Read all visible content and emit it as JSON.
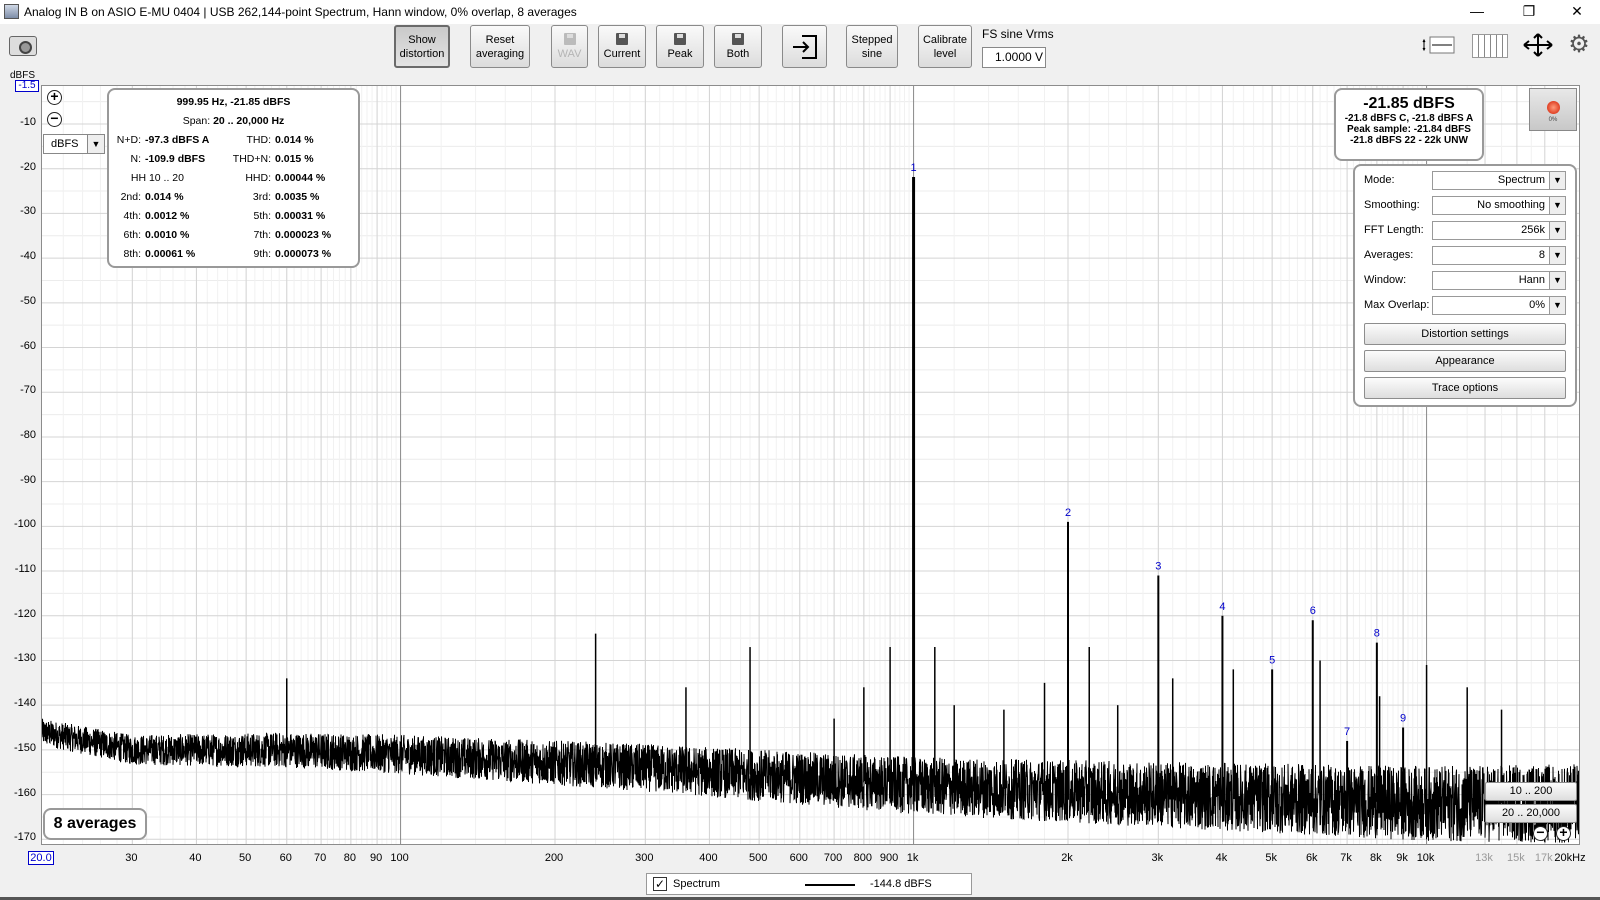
{
  "window": {
    "title": "Analog IN B on ASIO E-MU 0404 | USB 262,144-point Spectrum, Hann window, 0% overlap, 8 averages",
    "minimize": "—",
    "restore": "❐",
    "close": "✕"
  },
  "toolbar": {
    "show_distortion": [
      "Show",
      "distortion"
    ],
    "reset_averaging": [
      "Reset",
      "averaging"
    ],
    "wav": "WAV",
    "current": "Current",
    "peak": "Peak",
    "both": "Both",
    "stepped_sine": [
      "Stepped",
      "sine"
    ],
    "calibrate_level": [
      "Calibrate",
      "level"
    ],
    "fs_label": "FS sine Vrms",
    "fs_value": "1.0000 V",
    "icons": [
      "camera-icon",
      "import-icon",
      "layout-icon",
      "bars-icon",
      "arrows-icon",
      "gear-icon"
    ]
  },
  "unit_select": "dBFS",
  "distortion_panel": {
    "header1": "999.95 Hz, -21.85 dBFS",
    "header2_label": "Span:",
    "header2_value": "20 .. 20,000 Hz",
    "rows": [
      {
        "l1": "N+D:",
        "v1": "-97.3 dBFS A",
        "l2": "THD:",
        "v2": "0.014 %"
      },
      {
        "l1": "N:",
        "v1": "-109.9 dBFS",
        "l2": "THD+N:",
        "v2": "0.015 %"
      },
      {
        "l1": "HH 10 .. 20",
        "v1": "",
        "l2": "HHD:",
        "v2": "0.00044 %"
      },
      {
        "l1": "2nd:",
        "v1": "0.014 %",
        "l2": "3rd:",
        "v2": "0.0035 %"
      },
      {
        "l1": "4th:",
        "v1": "0.0012 %",
        "l2": "5th:",
        "v2": "0.00031 %"
      },
      {
        "l1": "6th:",
        "v1": "0.0010 %",
        "l2": "7th:",
        "v2": "0.000023 %"
      },
      {
        "l1": "8th:",
        "v1": "0.00061 %",
        "l2": "9th:",
        "v2": "0.000073 %"
      }
    ]
  },
  "level_panel": {
    "big": "-21.85 dBFS",
    "line1": "-21.8 dBFS C, -21.8 dBFS A",
    "line2": "Peak sample: -21.84 dBFS",
    "line3": "-21.8 dBFS 22 - 22k UNW",
    "rec_pct": "0%"
  },
  "settings": {
    "rows": [
      {
        "label": "Mode:",
        "value": "Spectrum"
      },
      {
        "label": "Smoothing:",
        "value": "No  smoothing"
      },
      {
        "label": "FFT Length:",
        "value": "256k"
      },
      {
        "label": "Averages:",
        "value": "8"
      },
      {
        "label": "Window:",
        "value": "Hann"
      },
      {
        "label": "Max Overlap:",
        "value": "0%"
      }
    ],
    "buttons": [
      "Distortion settings",
      "Appearance",
      "Trace options"
    ]
  },
  "averages_badge": "8 averages",
  "range_buttons": [
    "10 .. 200",
    "20 .. 20,000"
  ],
  "legend": {
    "checked": "✓",
    "name": "Spectrum",
    "value": "-144.8 dBFS"
  },
  "chart_data": {
    "type": "line",
    "y_unit": "dBFS",
    "y_top_label": "-1.5",
    "x_left_label": "20.0",
    "xscale": "log",
    "xlim": [
      20,
      20000
    ],
    "ylim": [
      -171.5,
      -1.5
    ],
    "yticks": [
      -10,
      -20,
      -30,
      -40,
      -50,
      -60,
      -70,
      -80,
      -90,
      -100,
      -110,
      -120,
      -130,
      -140,
      -150,
      -160,
      -170
    ],
    "xticks": [
      {
        "v": 30,
        "t": "30"
      },
      {
        "v": 40,
        "t": "40"
      },
      {
        "v": 50,
        "t": "50"
      },
      {
        "v": 60,
        "t": "60"
      },
      {
        "v": 70,
        "t": "70"
      },
      {
        "v": 80,
        "t": "80"
      },
      {
        "v": 90,
        "t": "90"
      },
      {
        "v": 100,
        "t": "100"
      },
      {
        "v": 200,
        "t": "200"
      },
      {
        "v": 300,
        "t": "300"
      },
      {
        "v": 400,
        "t": "400"
      },
      {
        "v": 500,
        "t": "500"
      },
      {
        "v": 600,
        "t": "600"
      },
      {
        "v": 700,
        "t": "700"
      },
      {
        "v": 800,
        "t": "800"
      },
      {
        "v": 900,
        "t": "900"
      },
      {
        "v": 1000,
        "t": "1k"
      },
      {
        "v": 2000,
        "t": "2k"
      },
      {
        "v": 3000,
        "t": "3k"
      },
      {
        "v": 4000,
        "t": "4k"
      },
      {
        "v": 5000,
        "t": "5k"
      },
      {
        "v": 6000,
        "t": "6k"
      },
      {
        "v": 7000,
        "t": "7k"
      },
      {
        "v": 8000,
        "t": "8k"
      },
      {
        "v": 9000,
        "t": "9k"
      },
      {
        "v": 10000,
        "t": "10k"
      },
      {
        "v": 13000,
        "t": "13k",
        "grey": true
      },
      {
        "v": 15000,
        "t": "15k",
        "grey": true
      },
      {
        "v": 17000,
        "t": "17k",
        "grey": true
      },
      {
        "v": 20000,
        "t": "20kHz"
      }
    ],
    "noise_floor": [
      [
        20,
        -146
      ],
      [
        30,
        -150
      ],
      [
        60,
        -150
      ],
      [
        100,
        -151
      ],
      [
        300,
        -154
      ],
      [
        1000,
        -158
      ],
      [
        3000,
        -160
      ],
      [
        10000,
        -162
      ],
      [
        20000,
        -162
      ]
    ],
    "harmonics": [
      {
        "label": "1",
        "f": 1000,
        "db": -21.85
      },
      {
        "label": "2",
        "f": 2000,
        "db": -99
      },
      {
        "label": "3",
        "f": 3000,
        "db": -111
      },
      {
        "label": "4",
        "f": 4000,
        "db": -120
      },
      {
        "label": "5",
        "f": 5000,
        "db": -132
      },
      {
        "label": "6",
        "f": 6000,
        "db": -121
      },
      {
        "label": "7",
        "f": 7000,
        "db": -148
      },
      {
        "label": "8",
        "f": 8000,
        "db": -126
      },
      {
        "label": "9",
        "f": 9000,
        "db": -145
      }
    ],
    "spurs": [
      {
        "f": 60,
        "db": -134
      },
      {
        "f": 240,
        "db": -124
      },
      {
        "f": 360,
        "db": -136
      },
      {
        "f": 480,
        "db": -127
      },
      {
        "f": 900,
        "db": -127
      },
      {
        "f": 1100,
        "db": -127
      },
      {
        "f": 2200,
        "db": -127
      },
      {
        "f": 3200,
        "db": -134
      },
      {
        "f": 4200,
        "db": -132
      },
      {
        "f": 6200,
        "db": -130
      },
      {
        "f": 8100,
        "db": -138
      },
      {
        "f": 10000,
        "db": -131
      },
      {
        "f": 12000,
        "db": -136
      },
      {
        "f": 14000,
        "db": -141
      },
      {
        "f": 700,
        "db": -143
      },
      {
        "f": 800,
        "db": -136
      },
      {
        "f": 1200,
        "db": -140
      },
      {
        "f": 1500,
        "db": -141
      },
      {
        "f": 1800,
        "db": -135
      },
      {
        "f": 2500,
        "db": -140
      }
    ]
  }
}
